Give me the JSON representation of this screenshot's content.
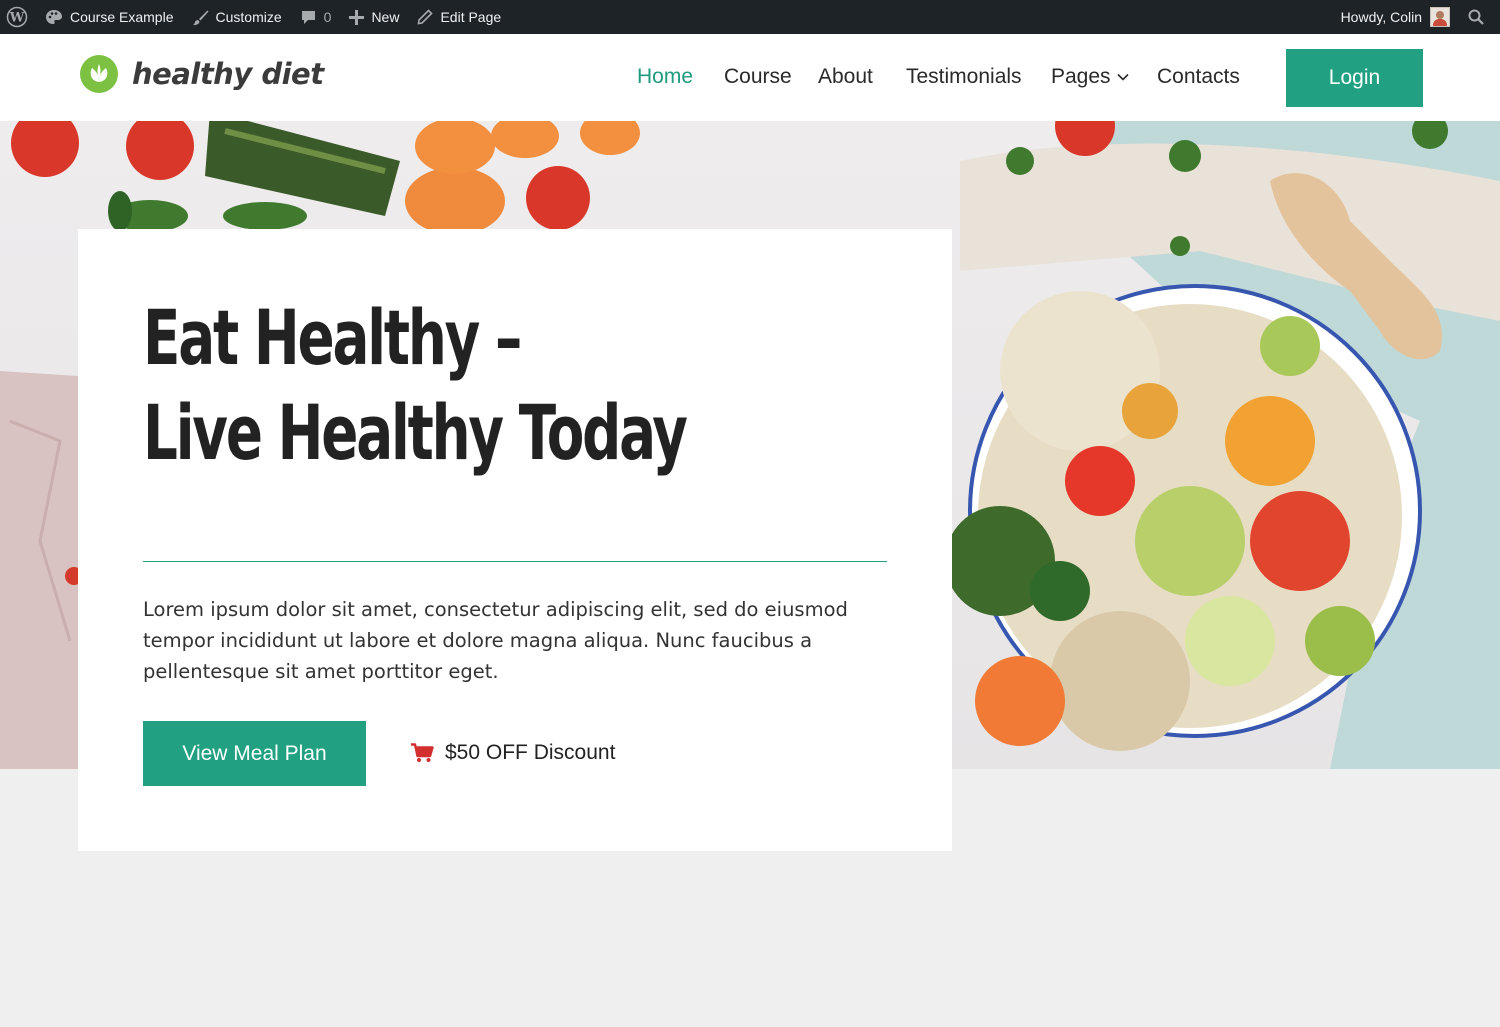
{
  "admin_bar": {
    "site_name": "Course Example",
    "customize": "Customize",
    "comments_count": "0",
    "new": "New",
    "edit_page": "Edit Page",
    "greeting": "Howdy, Colin"
  },
  "header": {
    "logo_text": "healthy diet",
    "nav": [
      "Home",
      "Course",
      "About",
      "Testimonials",
      "Pages",
      "Contacts"
    ],
    "active_nav": "Home",
    "login": "Login"
  },
  "hero": {
    "headline_line1": "Eat Healthy –",
    "headline_line2": "Live Healthy Today",
    "text": "Lorem ipsum dolor sit amet, consectetur adipiscing elit, sed do eiusmod tempor incididunt ut labore et dolore magna aliqua. Nunc faucibus a pellentesque sit amet porttitor eget.",
    "cta": "View Meal Plan",
    "discount": "$50 OFF Discount"
  },
  "colors": {
    "accent": "#21a082",
    "admin_bar": "#1d2327",
    "cart_icon": "#d32f2f",
    "logo_icon": "#7dc142"
  },
  "icons": [
    "wordpress-icon",
    "palette-icon",
    "brush-icon",
    "comment-icon",
    "plus-icon",
    "pencil-icon",
    "avatar",
    "search-icon",
    "leaf-logo-icon",
    "chevron-down-icon",
    "cart-icon"
  ]
}
